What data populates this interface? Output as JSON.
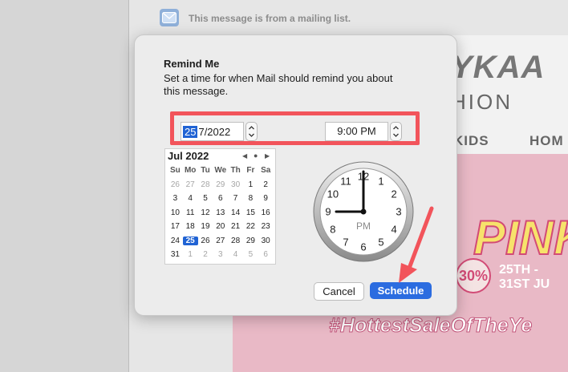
{
  "background": {
    "mailing_notice": "This message is from a mailing list.",
    "brand_top": "YKAA",
    "brand_bottom": "HION",
    "nav_kids": "KIDS",
    "nav_home": "HOM",
    "promo_word": "PINK",
    "promo_off": "30%",
    "promo_dates": "25TH - 31ST JU",
    "promo_hashtag": "#HottestSaleOfTheYe"
  },
  "dialog": {
    "title": "Remind Me",
    "description": "Set a time for when Mail should remind you about this message.",
    "date": {
      "day": "25",
      "rest": "7/2022"
    },
    "time": "9:00 PM",
    "calendar": {
      "month": "Jul 2022",
      "weekdays": [
        "Su",
        "Mo",
        "Tu",
        "We",
        "Th",
        "Fr",
        "Sa"
      ],
      "weeks": [
        [
          "26",
          "27",
          "28",
          "29",
          "30",
          "1",
          "2"
        ],
        [
          "3",
          "4",
          "5",
          "6",
          "7",
          "8",
          "9"
        ],
        [
          "10",
          "11",
          "12",
          "13",
          "14",
          "15",
          "16"
        ],
        [
          "17",
          "18",
          "19",
          "20",
          "21",
          "22",
          "23"
        ],
        [
          "24",
          "25",
          "26",
          "27",
          "28",
          "29",
          "30"
        ],
        [
          "31",
          "1",
          "2",
          "3",
          "4",
          "5",
          "6"
        ]
      ],
      "selected_day": "25"
    },
    "clock": {
      "numbers": [
        "12",
        "1",
        "2",
        "3",
        "4",
        "5",
        "6",
        "7",
        "8",
        "9",
        "10",
        "11"
      ],
      "period": "PM",
      "hour": 9,
      "minute": 0
    },
    "cancel_label": "Cancel",
    "schedule_label": "Schedule"
  },
  "colors": {
    "accent": "#2b6ce0",
    "highlight": "#f2545b"
  }
}
